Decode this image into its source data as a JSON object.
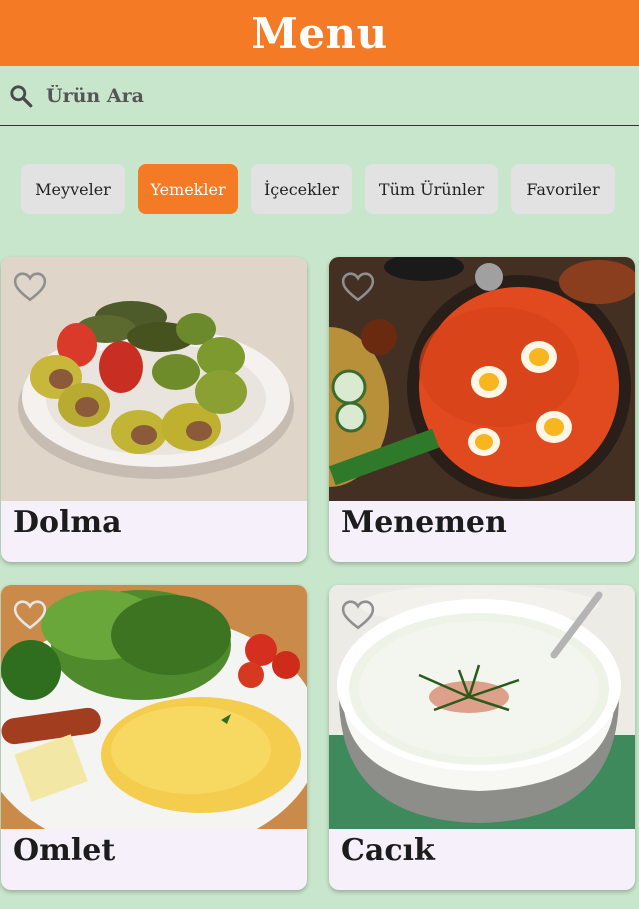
{
  "header": {
    "title": "Menu"
  },
  "search": {
    "placeholder": "Ürün Ara",
    "icon": "search-icon"
  },
  "categories": [
    {
      "label": "Meyveler",
      "active": false
    },
    {
      "label": "Yemekler",
      "active": true
    },
    {
      "label": "İçecekler",
      "active": false
    },
    {
      "label": "Tüm Ürünler",
      "active": false
    },
    {
      "label": "Favoriler",
      "active": false
    }
  ],
  "products": [
    {
      "name": "Dolma",
      "favorite": false
    },
    {
      "name": "Menemen",
      "favorite": false
    },
    {
      "name": "Omlet",
      "favorite": false
    },
    {
      "name": "Cacık",
      "favorite": false
    }
  ],
  "colors": {
    "accent": "#f47a25",
    "background": "#c8e6cb",
    "chip": "#e2e2e2",
    "card": "#f5f0f9"
  }
}
